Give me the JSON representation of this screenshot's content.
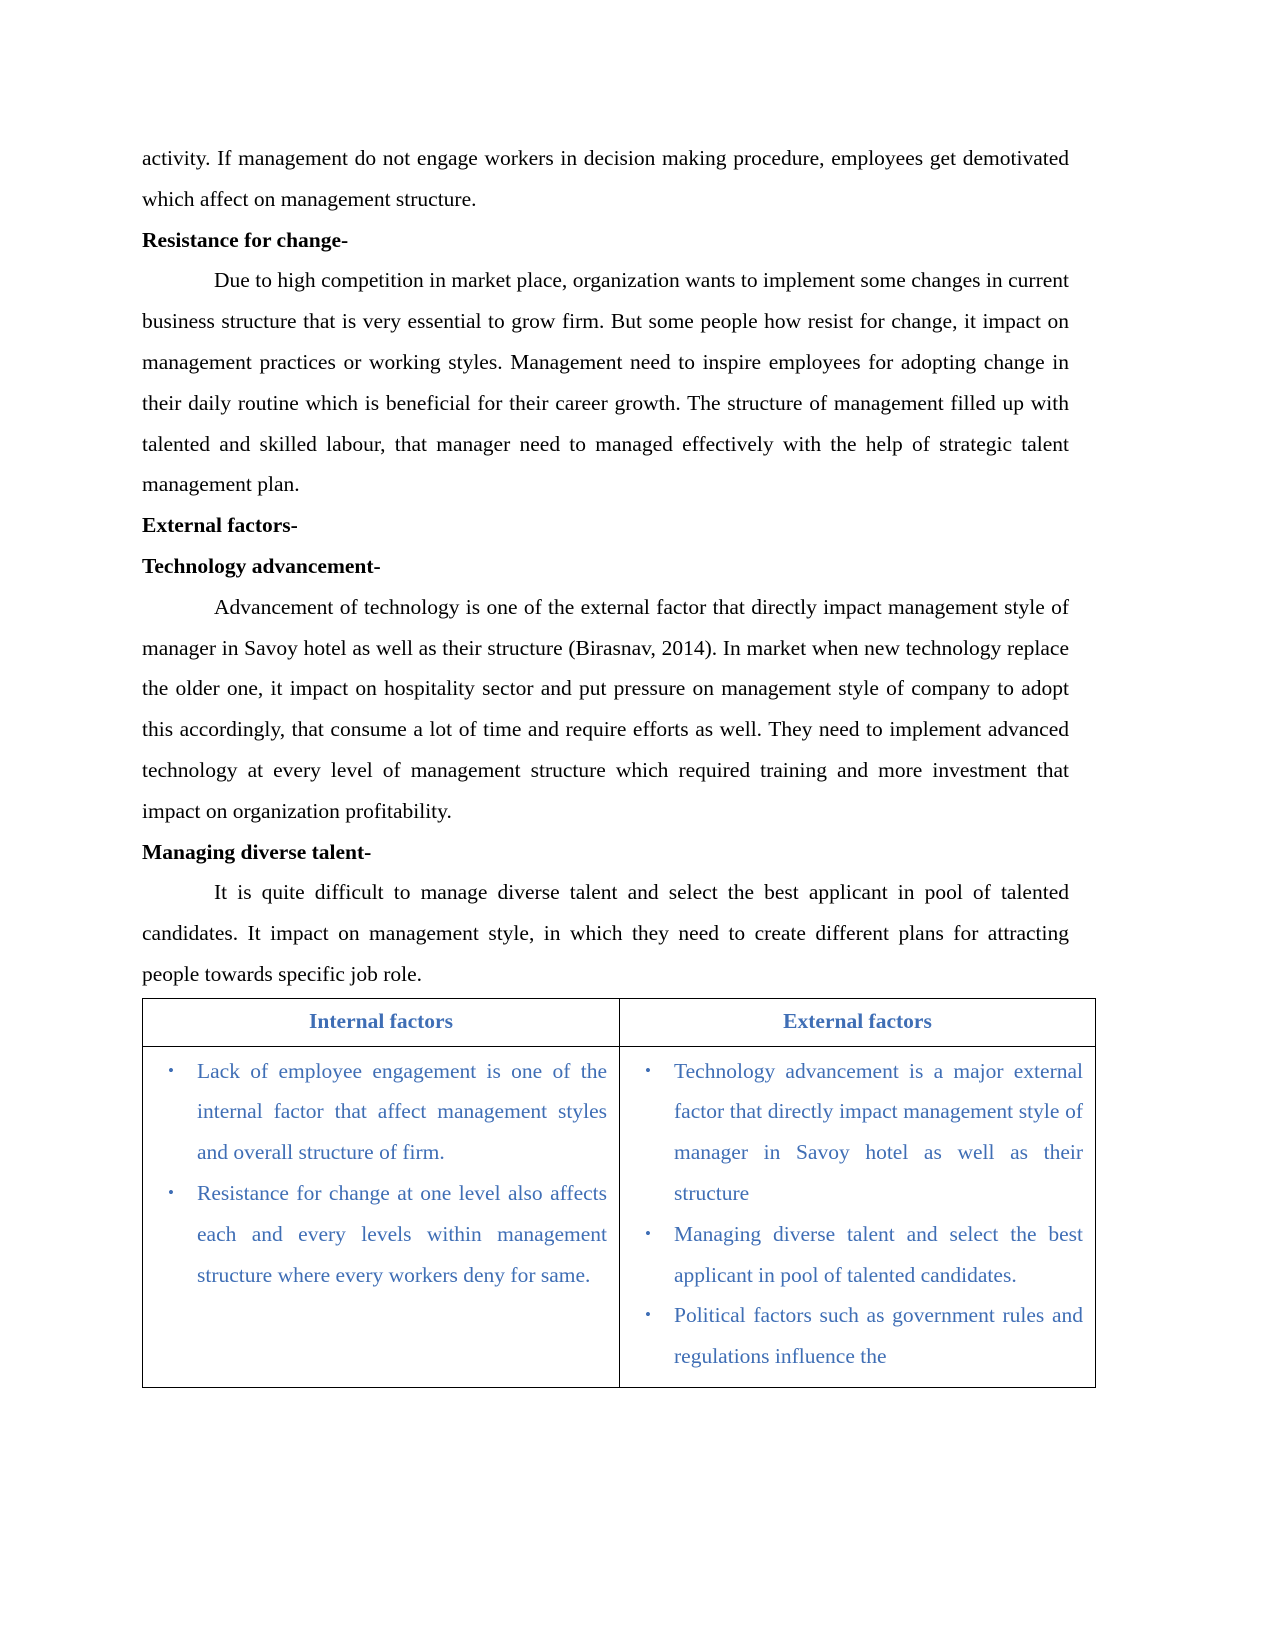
{
  "document": {
    "page_background": "#ffffff",
    "body_text_color": "#000000",
    "accent_color": "#3f6eb5",
    "table_border_color": "#000000"
  },
  "blocks": {
    "para_continuation": "activity. If management do not engage workers in decision making procedure, employees get demotivated which affect on management structure.",
    "heading_resistance": "Resistance for change-",
    "para_resistance": "Due to high competition in market place, organization wants to implement some changes in current business structure that is very essential to grow firm. But some people how resist for change, it impact on management practices or working styles. Management need to inspire employees for adopting change in their daily routine which is beneficial for their career growth. The structure of management filled up with talented and skilled labour, that manager need to managed effectively with the help of strategic talent management plan.",
    "heading_external_factors": "External factors-",
    "heading_technology": "Technology advancement-",
    "para_technology": "Advancement of technology is one of the external factor that directly impact management style of manager in Savoy hotel as well as their structure (Birasnav, 2014). In market when new technology replace the older one, it impact on hospitality sector and put pressure on management style of company to adopt this accordingly, that consume a lot of time and require efforts as well. They need to implement advanced technology at every level of management structure which required training and more investment that impact on organization profitability.",
    "heading_managing_talent": "Managing diverse talent-",
    "para_managing_talent": "It is quite difficult to manage diverse talent and select the best applicant in pool of talented candidates. It impact on management style, in which they need to create different plans for attracting people towards specific job role."
  },
  "factors_table": {
    "headers": [
      "Internal factors",
      "External factors"
    ],
    "columns": [
      {
        "header": "Internal factors",
        "items": [
          "Lack of employee engagement is one of the internal factor that affect management styles and overall structure of firm.",
          "Resistance for change at one level also affects each and every levels within management structure where every workers deny for same."
        ]
      },
      {
        "header": "External factors",
        "items": [
          "Technology advancement is a major external factor that directly impact management style of manager in Savoy hotel as well as their structure",
          "Managing diverse talent and select the best applicant in pool of talented candidates.",
          "Political factors such as government rules and regulations influence the"
        ]
      }
    ]
  }
}
